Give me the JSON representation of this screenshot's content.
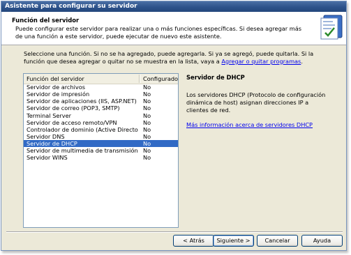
{
  "window": {
    "title": "Asistente para configurar su servidor"
  },
  "header": {
    "title": "Función del servidor",
    "subtitle": "Puede configurar este servidor para realizar una o más funciones específicas. Si desea agregar más de una función a este servidor, puede ejecutar de nuevo este asistente."
  },
  "intro": {
    "text": "Seleccione una función. Si no se ha agregado, puede agregarla. Si ya se agregó, puede quitarla. Si la función que desea agregar o quitar no se muestra en la lista, vaya a",
    "link": "Agregar o quitar programas",
    "suffix": "."
  },
  "list": {
    "columns": [
      "Función del servidor",
      "Configurado"
    ],
    "rows": [
      {
        "role": "Servidor de archivos",
        "configured": "No"
      },
      {
        "role": "Servidor de impresión",
        "configured": "No"
      },
      {
        "role": "Servidor de aplicaciones (IIS, ASP.NET)",
        "configured": "No"
      },
      {
        "role": "Servidor de correo (POP3, SMTP)",
        "configured": "No"
      },
      {
        "role": "Terminal Server",
        "configured": "No"
      },
      {
        "role": "Servidor de acceso remoto/VPN",
        "configured": "No"
      },
      {
        "role": "Controlador de dominio (Active Directory)",
        "configured": "No"
      },
      {
        "role": "Servidor DNS",
        "configured": "No"
      },
      {
        "role": "Servidor de DHCP",
        "configured": "No"
      },
      {
        "role": "Servidor de multimedia de transmisión po...",
        "configured": "No"
      },
      {
        "role": "Servidor WINS",
        "configured": "No"
      }
    ],
    "selected_index": 8
  },
  "info": {
    "title": "Servidor de DHCP",
    "text": "Los servidores DHCP (Protocolo de configuración dinámica de host) asignan direcciones IP a clientes de red.",
    "link": "Más información acerca de servidores DHCP"
  },
  "buttons": {
    "back": "< Atrás",
    "next": "Siguiente >",
    "cancel": "Cancelar",
    "help": "Ayuda"
  },
  "colors": {
    "titlebar": "#2d528a",
    "selection": "#316ac5",
    "link": "#0000ee",
    "dialog_bg": "#ece9d8"
  },
  "icons": {
    "header": "wizard-server-icon"
  }
}
